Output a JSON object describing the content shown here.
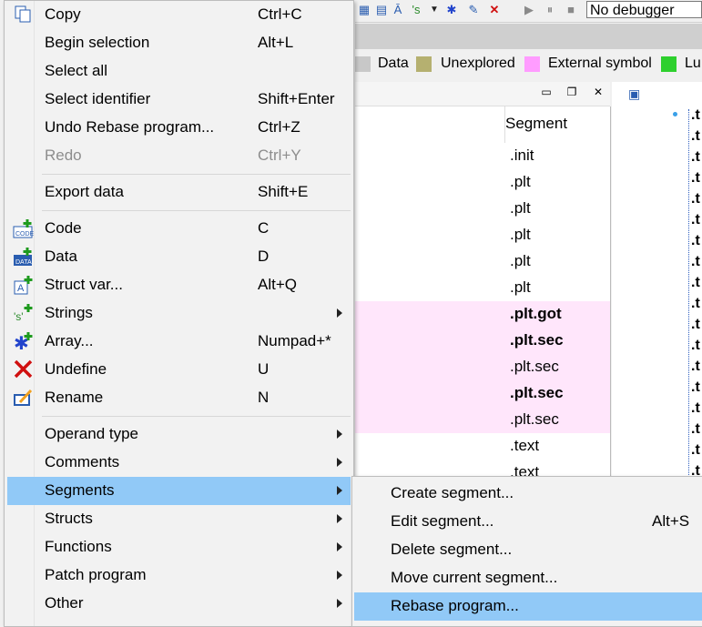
{
  "toolbar": {
    "debugger_select": "No debugger"
  },
  "legend": [
    {
      "label": "Data",
      "color": "#c8c8c8"
    },
    {
      "label": "Unexplored",
      "color": "#b5b070"
    },
    {
      "label": "External symbol",
      "color": "#ff9cff"
    },
    {
      "label": "Lu",
      "color": "#2ed02e"
    }
  ],
  "segments_panel": {
    "header": "Segment",
    "rows": [
      {
        "name": ".init",
        "highlight": false,
        "bold": false
      },
      {
        "name": ".plt",
        "highlight": false,
        "bold": false
      },
      {
        "name": ".plt",
        "highlight": false,
        "bold": false
      },
      {
        "name": ".plt",
        "highlight": false,
        "bold": false
      },
      {
        "name": ".plt",
        "highlight": false,
        "bold": false
      },
      {
        "name": ".plt",
        "highlight": false,
        "bold": false
      },
      {
        "name": ".plt.got",
        "highlight": true,
        "bold": true
      },
      {
        "name": ".plt.sec",
        "highlight": true,
        "bold": true
      },
      {
        "name": ".plt.sec",
        "highlight": true,
        "bold": false
      },
      {
        "name": ".plt.sec",
        "highlight": true,
        "bold": true
      },
      {
        "name": ".plt.sec",
        "highlight": true,
        "bold": false
      },
      {
        "name": ".text",
        "highlight": false,
        "bold": false
      },
      {
        "name": ".text",
        "highlight": false,
        "bold": false
      }
    ]
  },
  "right_panel": {
    "line_text": ".t"
  },
  "menu": {
    "items": [
      {
        "label": "Copy",
        "shortcut": "Ctrl+C",
        "icon": "copy-icon"
      },
      {
        "label": "Begin selection",
        "shortcut": "Alt+L"
      },
      {
        "label": "Select all",
        "shortcut": ""
      },
      {
        "label": "Select identifier",
        "shortcut": "Shift+Enter"
      },
      {
        "label": "Undo Rebase program...",
        "shortcut": "Ctrl+Z"
      },
      {
        "label": "Redo",
        "shortcut": "Ctrl+Y",
        "disabled": true
      },
      {
        "label": "Export data",
        "shortcut": "Shift+E"
      },
      {
        "label": "Code",
        "shortcut": "C",
        "icon": "code-icon"
      },
      {
        "label": "Data",
        "shortcut": "D",
        "icon": "data-icon"
      },
      {
        "label": "Struct var...",
        "shortcut": "Alt+Q",
        "icon": "struct-var-icon"
      },
      {
        "label": "Strings",
        "shortcut": "",
        "submenu": true,
        "icon": "strings-icon"
      },
      {
        "label": "Array...",
        "shortcut": "Numpad+*",
        "icon": "array-icon"
      },
      {
        "label": "Undefine",
        "shortcut": "U",
        "icon": "undefine-icon"
      },
      {
        "label": "Rename",
        "shortcut": "N",
        "icon": "rename-icon"
      },
      {
        "label": "Operand type",
        "shortcut": "",
        "submenu": true
      },
      {
        "label": "Comments",
        "shortcut": "",
        "submenu": true
      },
      {
        "label": "Segments",
        "shortcut": "",
        "submenu": true,
        "selected": true
      },
      {
        "label": "Structs",
        "shortcut": "",
        "submenu": true
      },
      {
        "label": "Functions",
        "shortcut": "",
        "submenu": true
      },
      {
        "label": "Patch program",
        "shortcut": "",
        "submenu": true
      },
      {
        "label": "Other",
        "shortcut": "",
        "submenu": true
      }
    ]
  },
  "submenu": {
    "items": [
      {
        "label": "Create segment...",
        "shortcut": ""
      },
      {
        "label": "Edit segment...",
        "shortcut": "Alt+S"
      },
      {
        "label": "Delete segment...",
        "shortcut": ""
      },
      {
        "label": "Move current segment...",
        "shortcut": ""
      },
      {
        "label": "Rebase program...",
        "shortcut": "",
        "selected": true
      }
    ]
  }
}
